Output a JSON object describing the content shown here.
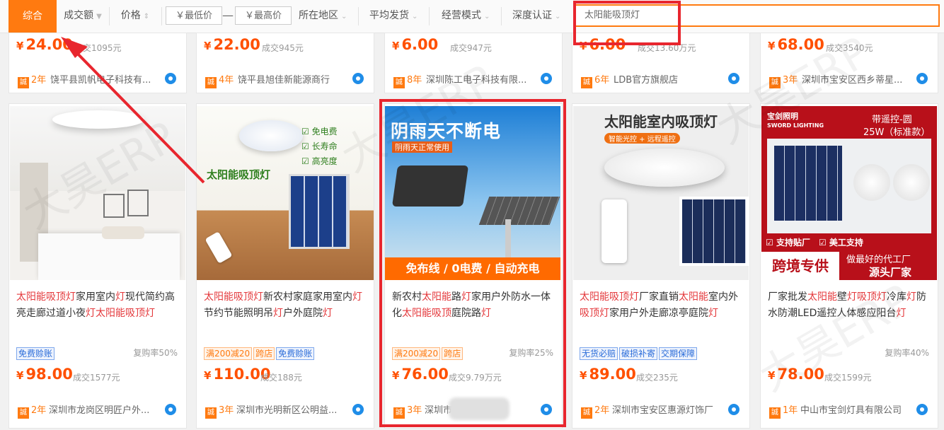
{
  "toolbar": {
    "sort_comprehensive": "综合",
    "sort_volume": "成交额",
    "sort_price": "价格",
    "min_price": "￥最低价",
    "max_price": "￥最高价",
    "dash": "—",
    "filter_region": "所在地区",
    "filter_shipping": "平均发货",
    "filter_mode": "经营模式",
    "filter_cert": "深度认证",
    "search_value": "太阳能吸顶灯"
  },
  "top_row": [
    {
      "price": "24.00",
      "sold": "成交1095元",
      "years": "2年",
      "shop": "饶平县凯帆电子科技有..."
    },
    {
      "price": "22.00",
      "sold": "成交945元",
      "years": "4年",
      "shop": "饶平县旭佳新能源商行"
    },
    {
      "price": "6.00",
      "sold": "成交947元",
      "years": "8年",
      "shop": "深圳陈工电子科技有限..."
    },
    {
      "price": "6.00",
      "sold": "成交13.60万元",
      "years": "6年",
      "shop": "LDB官方旗舰店"
    },
    {
      "price": "68.00",
      "sold": "成交3540元",
      "years": "3年",
      "shop": "深圳市宝安区西乡蒂星..."
    }
  ],
  "products": [
    {
      "img_text": "",
      "title_parts": [
        {
          "t": "太阳能吸顶灯",
          "hl": true
        },
        {
          "t": "家用室内",
          "hl": false
        },
        {
          "t": "灯",
          "hl": true
        },
        {
          "t": "现代简约高亮走廊过道小夜",
          "hl": false
        },
        {
          "t": "灯",
          "hl": true
        },
        {
          "t": "太阳能吸顶灯",
          "hl": true
        }
      ],
      "tags": [
        {
          "t": "免费赊账",
          "c": "blue"
        }
      ],
      "rate": "复购率50%",
      "price": "98.00",
      "sold": "成交1577元",
      "years": "2年",
      "shop": "深圳市龙岗区明匠户外..."
    },
    {
      "img_text": "太阳能吸顶灯",
      "img_checks": [
        "免电费",
        "长寿命",
        "高亮度"
      ],
      "title_parts": [
        {
          "t": "太阳能吸顶灯",
          "hl": true
        },
        {
          "t": "新农村家庭家用室内",
          "hl": false
        },
        {
          "t": "灯",
          "hl": true
        },
        {
          "t": "节约节能照明吊",
          "hl": false
        },
        {
          "t": "灯",
          "hl": true
        },
        {
          "t": "户外庭院",
          "hl": false
        },
        {
          "t": "灯",
          "hl": true
        }
      ],
      "tags": [
        {
          "t": "满200减20",
          "c": "orange"
        },
        {
          "t": "跨店",
          "c": "orange"
        },
        {
          "t": "免费赊账",
          "c": "blue"
        }
      ],
      "rate": "",
      "price": "110.00",
      "sold": "成交188元",
      "years": "3年",
      "shop": "深圳市光明新区公明益..."
    },
    {
      "img_headline": "阴雨天不断电",
      "img_sub": "阴雨天正常使用",
      "img_banner": "免布线 / 0电费 / 自动充电",
      "title_parts": [
        {
          "t": "新农村",
          "hl": false
        },
        {
          "t": "太阳能",
          "hl": true
        },
        {
          "t": "路",
          "hl": false
        },
        {
          "t": "灯",
          "hl": true
        },
        {
          "t": "家用户外防水一体化",
          "hl": false
        },
        {
          "t": "太阳能吸顶",
          "hl": true
        },
        {
          "t": "庭院路",
          "hl": false
        },
        {
          "t": "灯",
          "hl": true
        }
      ],
      "tags": [
        {
          "t": "满200减20",
          "c": "orange"
        },
        {
          "t": "跨店",
          "c": "orange"
        }
      ],
      "rate": "复购率25%",
      "price": "76.00",
      "sold": "成交9.79万元",
      "years": "3年",
      "shop": "深圳市                公司"
    },
    {
      "img_headline": "太阳能室内吸顶灯",
      "img_sub": "智能光控 + 远程遥控",
      "title_parts": [
        {
          "t": "太阳能吸顶灯",
          "hl": true
        },
        {
          "t": "厂家直销",
          "hl": false
        },
        {
          "t": "太阳能",
          "hl": true
        },
        {
          "t": "室内外",
          "hl": false
        },
        {
          "t": "吸顶灯",
          "hl": true
        },
        {
          "t": "家用户外走廊凉亭庭院",
          "hl": false
        },
        {
          "t": "灯",
          "hl": true
        }
      ],
      "tags": [
        {
          "t": "无货必赔",
          "c": "blue"
        },
        {
          "t": "破损补寄",
          "c": "blue"
        },
        {
          "t": "交期保障",
          "c": "blue"
        }
      ],
      "rate": "",
      "price": "89.00",
      "sold": "成交235元",
      "years": "2年",
      "shop": "深圳市宝安区惠源灯饰厂"
    },
    {
      "img_brand": "宝剑照明",
      "img_brand_en": "SWORD LIGHTING",
      "img_top": "带遥控-圆",
      "img_power": "25W（标准款）",
      "img_support1": "支持贴厂",
      "img_support2": "美工支持",
      "img_cross": "跨境专供",
      "img_oem": "做最好的代工厂",
      "img_source": "源头厂家",
      "title_parts": [
        {
          "t": "厂家批发",
          "hl": false
        },
        {
          "t": "太阳能",
          "hl": true
        },
        {
          "t": "壁",
          "hl": false
        },
        {
          "t": "灯吸顶灯",
          "hl": true
        },
        {
          "t": "冷库",
          "hl": false
        },
        {
          "t": "灯",
          "hl": true
        },
        {
          "t": "防水防潮LED遥控人体感应阳台",
          "hl": false
        },
        {
          "t": "灯",
          "hl": true
        }
      ],
      "tags": [],
      "rate": "复购率40%",
      "price": "78.00",
      "sold": "成交1599元",
      "years": "1年",
      "shop": "中山市宝剑灯具有限公司"
    }
  ],
  "colors": {
    "accent": "#ff7a10",
    "price": "#ff5000",
    "highlight": "#e4393c",
    "annotation": "#e8262e"
  }
}
